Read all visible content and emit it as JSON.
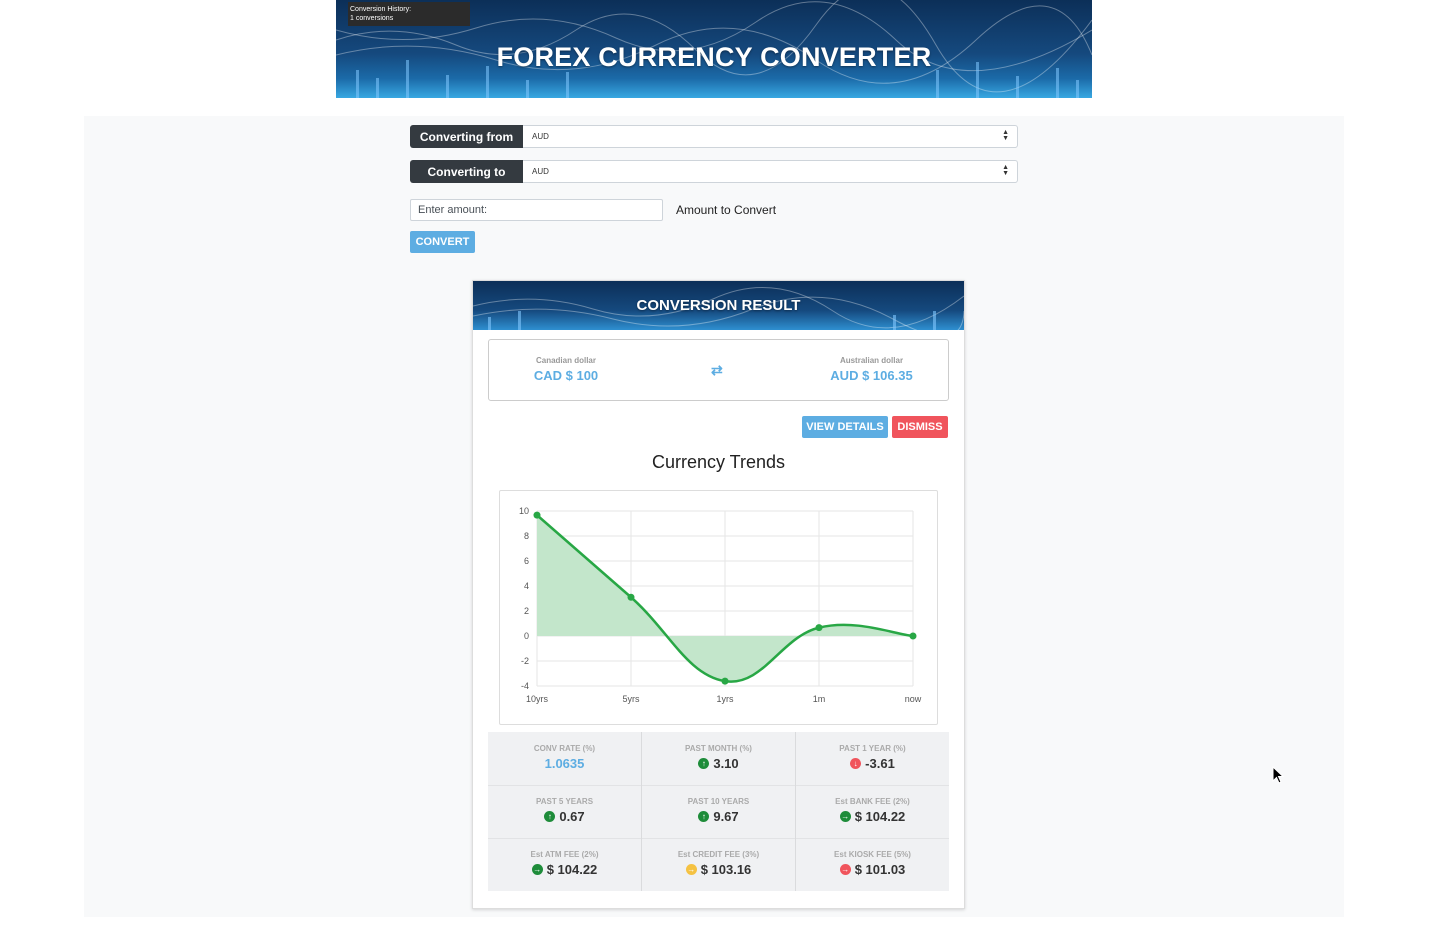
{
  "header": {
    "title": "FOREX CURRENCY CONVERTER",
    "history_line1": "Conversion History:",
    "history_line2": "1 conversions"
  },
  "form": {
    "from_label": "Converting from",
    "from_value": "AUD",
    "to_label": "Converting to",
    "to_value": "AUD",
    "amount_placeholder": "Enter amount:",
    "amount_label": "Amount to Convert",
    "convert_label": "CONVERT"
  },
  "result": {
    "title": "CONVERSION RESULT",
    "from_name": "Canadian dollar",
    "from_amount": "CAD $ 100",
    "to_name": "Australian dollar",
    "to_amount": "AUD $ 106.35",
    "swap_icon": "⇄",
    "details_label": "VIEW DETAILS",
    "dismiss_label": "DISMISS"
  },
  "chart_data": {
    "type": "area",
    "title": "Currency Trends",
    "categories": [
      "10yrs",
      "5yrs",
      "1yrs",
      "1m",
      "now"
    ],
    "series": [
      {
        "values": [
          9.67,
          3.1,
          -3.61,
          0.67,
          0
        ]
      }
    ],
    "ylim": [
      -4,
      10
    ],
    "yticks": [
      10,
      8,
      6,
      4,
      2,
      0,
      -2,
      -4
    ],
    "grid": true,
    "color": "#28a745",
    "fill": "#c3e6cb"
  },
  "stats": [
    [
      {
        "label": "CONV RATE (%)",
        "value": "1.0635",
        "icon": "",
        "style": "blue"
      },
      {
        "label": "PAST MONTH (%)",
        "value": "3.10",
        "icon": "arrow-up-icon",
        "color": "#1e8c3a"
      },
      {
        "label": "PAST 1 YEAR (%)",
        "value": "-3.61",
        "icon": "arrow-down-icon",
        "color": "#f0545c"
      }
    ],
    [
      {
        "label": "PAST 5 YEARS",
        "value": "0.67",
        "icon": "arrow-up-icon",
        "color": "#1e8c3a"
      },
      {
        "label": "PAST 10 YEARS",
        "value": "9.67",
        "icon": "arrow-up-icon",
        "color": "#1e8c3a"
      },
      {
        "label": "Est BANK FEE (2%)",
        "value": "$ 104.22",
        "icon": "arrow-right-icon",
        "color": "#1e8c3a"
      }
    ],
    [
      {
        "label": "Est ATM FEE (2%)",
        "value": "$ 104.22",
        "icon": "arrow-right-icon",
        "color": "#1e8c3a"
      },
      {
        "label": "Est CREDIT FEE (3%)",
        "value": "$ 103.16",
        "icon": "arrow-right-icon",
        "color": "#f5c242"
      },
      {
        "label": "Est KIOSK FEE (5%)",
        "value": "$ 101.03",
        "icon": "arrow-right-icon",
        "color": "#f0545c"
      }
    ]
  ]
}
